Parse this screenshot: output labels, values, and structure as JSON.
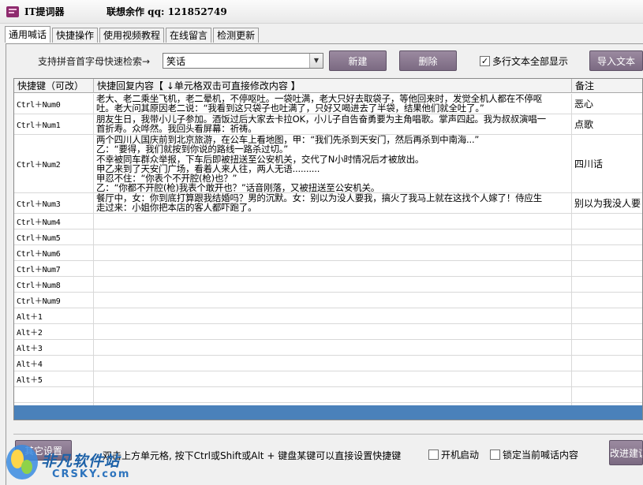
{
  "window": {
    "title": "IT提词器",
    "author": "联想余作 qq: 121852749"
  },
  "tabs": [
    {
      "label": "通用喊话",
      "active": true
    },
    {
      "label": "快捷操作"
    },
    {
      "label": "使用视频教程"
    },
    {
      "label": "在线留言"
    },
    {
      "label": "检测更新"
    }
  ],
  "toolbar": {
    "search_label": "支持拼音首字母快速检索→",
    "combo_value": "笑话",
    "new_button": "新建",
    "delete_button": "删除",
    "multiline_checkbox": {
      "label": "多行文本全部显示",
      "checked": true
    },
    "import_button": "导入文本"
  },
  "table": {
    "columns": [
      "快捷键（可改）",
      "快捷回复内容【 ↓单元格双击可直接修改内容 】",
      "备注"
    ],
    "rows": [
      {
        "key": "Ctrl＋Num0",
        "content": [
          "老大、老二乘坐飞机，老二晕机，不停呕吐。一袋吐满，老大只好去取袋子，等他回来时，发觉全机人都在不停呕",
          "吐。老大问其原因老二说：“我看到这只袋子也吐满了，只好又喝进去了半袋，结果他们就全吐了。”"
        ],
        "note": "恶心"
      },
      {
        "key": "Ctrl＋Num1",
        "content": [
          "朋友生日，我带小儿子参加。酒饭过后大家去卡拉OK，小儿子自告奋勇要为主角唱歌。掌声四起。我为叔叔演唱一",
          "首折寿。众哗然。我回头看屏幕：祈祷。"
        ],
        "note": "点歌"
      },
      {
        "key": "Ctrl＋Num2",
        "content": [
          "两个四川人国庆前到北京旅游，在公车上看地图，甲：“我们先杀到天安门，然后再杀到中南海...”",
          "乙：“要得，我们就按到你说的路线一路杀过切。”",
          "不幸被同车群众举报，下车后即被扭送至公安机关，交代了N小时情况后才被放出。",
          "甲乙来到了天安门广场，看着人来人往，两人无语..........",
          "甲忍不住：“你表个不开腔(枪)也？”",
          "乙：“你都不开腔(枪)我表个敢开也？”话音刚落，又被扭送至公安机关。"
        ],
        "note": "四川话"
      },
      {
        "key": "Ctrl＋Num3",
        "content": [
          "餐厅中，女：你到底打算跟我结婚吗？男的沉默。女：别以为没人要我，搞火了我马上就在这找个人嫁了！侍应生",
          "走过来：小姐你把本店的客人都吓跑了。"
        ],
        "note": "别以为我没人要"
      },
      {
        "key": "Ctrl＋Num4",
        "content": [],
        "note": ""
      },
      {
        "key": "Ctrl＋Num5",
        "content": [],
        "note": ""
      },
      {
        "key": "Ctrl＋Num6",
        "content": [],
        "note": ""
      },
      {
        "key": "Ctrl＋Num7",
        "content": [],
        "note": ""
      },
      {
        "key": "Ctrl＋Num8",
        "content": [],
        "note": ""
      },
      {
        "key": "Ctrl＋Num9",
        "content": [],
        "note": ""
      },
      {
        "key": "Alt＋1",
        "content": [],
        "note": ""
      },
      {
        "key": "Alt＋2",
        "content": [],
        "note": ""
      },
      {
        "key": "Alt＋3",
        "content": [],
        "note": ""
      },
      {
        "key": "Alt＋4",
        "content": [],
        "note": ""
      },
      {
        "key": "Alt＋5",
        "content": [],
        "note": ""
      }
    ]
  },
  "bottom": {
    "settings_button": "其它设置",
    "tip": "双击上方单元格, 按下Ctrl或Shift或Alt + 键盘某键可以直接设置快捷键",
    "autostart_checkbox": {
      "label": "开机启动",
      "checked": false
    },
    "lock_checkbox": {
      "label": "锁定当前喊话内容",
      "checked": false
    },
    "enter_button": "改进建议"
  },
  "watermark": {
    "name": "非凡软件站",
    "url": "CRSKY.com"
  },
  "colors": {
    "accent_button": "#8a7990",
    "selected_row": "#4a81ba"
  }
}
